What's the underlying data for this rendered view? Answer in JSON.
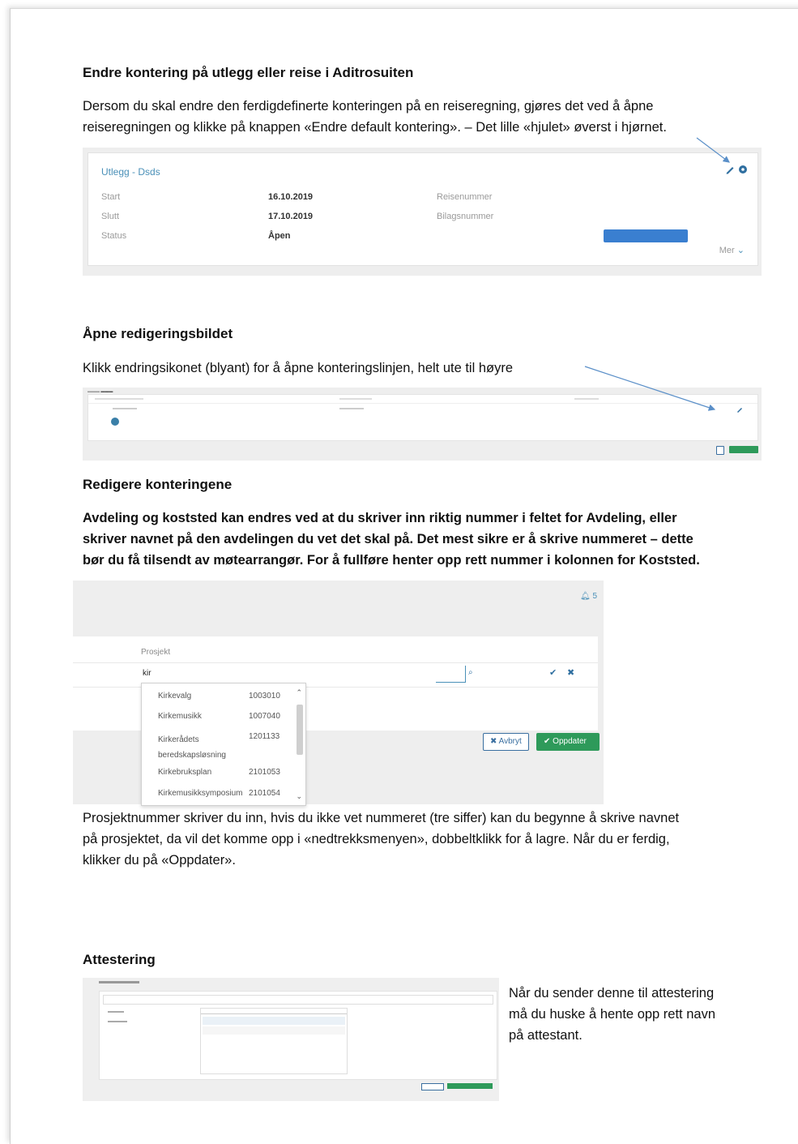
{
  "section1": {
    "heading": "Endre kontering på utlegg eller reise i Aditrosuiten",
    "para_line1": "Dersom du skal endre den ferdigdefinerte konteringen på en reiseregning, gjøres det ved å åpne",
    "para_line2": "reiseregningen og klikke på knappen «Endre default kontering». – Det lille «hjulet» øverst i hjørnet."
  },
  "shot1": {
    "title": "Utlegg - Dsds",
    "start_label": "Start",
    "start_value": "16.10.2019",
    "slutt_label": "Slutt",
    "slutt_value": "17.10.2019",
    "status_label": "Status",
    "status_value": "Åpen",
    "reisenummer_label": "Reisenummer",
    "bilagsnummer_label": "Bilagsnummer",
    "more_label": "Mer"
  },
  "section2": {
    "heading": "Åpne redigeringsbildet",
    "para": "Klikk endringsikonet (blyant) for å åpne konteringslinjen, helt ute til høyre"
  },
  "section3": {
    "heading": "Redigere konteringene",
    "bold_line1": "Avdeling og koststed kan endres ved at du skriver inn riktig nummer i feltet for Avdeling, eller",
    "bold_line2": "skriver navnet på den avdelingen du vet det skal på. Det mest sikre er å skrive nummeret – dette",
    "bold_line3": "bør du få tilsendt av møtearrangør. For å fullføre henter opp rett nummer i kolonnen for Koststed."
  },
  "shot3": {
    "notification_count": "5",
    "prosjekt_label": "Prosjekt",
    "input_value": "kir",
    "dropdown": [
      {
        "name": "Kirkevalg",
        "number": "1003010"
      },
      {
        "name": "Kirkemusikk",
        "number": "1007040"
      },
      {
        "name": "Kirkerådets beredskapsløsning",
        "number": "1201133"
      },
      {
        "name": "Kirkebruksplan",
        "number": "2101053"
      },
      {
        "name": "Kirkemusikksymposium",
        "number": "2101054"
      }
    ],
    "cancel_label": "Avbryt",
    "update_label": "Oppdater"
  },
  "section4": {
    "para_line1": "Prosjektnummer skriver du inn, hvis du ikke vet nummeret (tre siffer) kan du begynne å skrive navnet",
    "para_line2": "på prosjektet, da vil det komme opp i «nedtrekksmenyen», dobbeltklikk for å lagre. Når du er ferdig,",
    "para_line3": "klikker du på «Oppdater»."
  },
  "section5": {
    "heading": "Attestering",
    "side_line1": "Når du sender denne til attestering",
    "side_line2": "må du huske å hente opp rett navn",
    "side_line3": "på attestant."
  },
  "colors": {
    "accent_blue": "#4a90b8",
    "status_bar": "#3a7fd0",
    "ok_green": "#2e9a5a"
  }
}
